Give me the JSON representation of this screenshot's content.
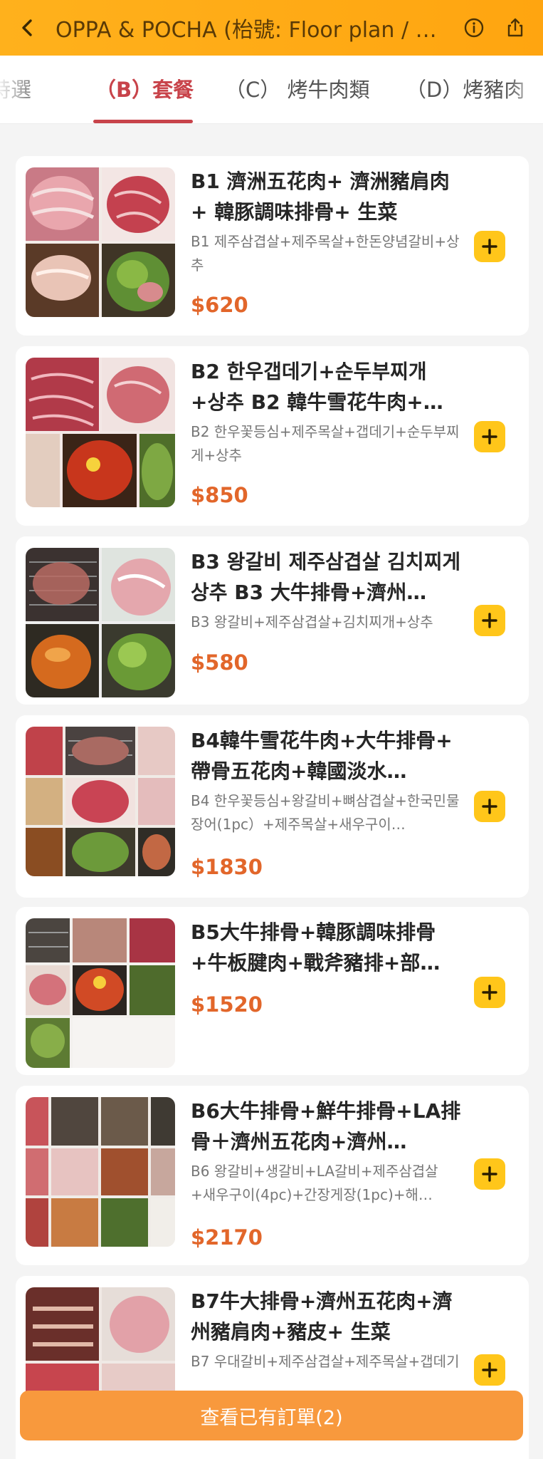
{
  "header": {
    "title": "OPPA & POCHA (枱號: Floor plan / …",
    "colors": {
      "bar": "#ffad16",
      "icon": "#4a3205"
    }
  },
  "tabs": [
    {
      "label": "特選",
      "active": false
    },
    {
      "label": "（B）套餐",
      "active": true
    },
    {
      "label": "（C） 烤牛肉類",
      "active": false
    },
    {
      "label": "（D）烤豬肉",
      "active": false
    }
  ],
  "menu": {
    "items": [
      {
        "title": "B1 濟洲五花肉+ 濟洲豬肩肉+ 韓豚調味排骨+ 生菜",
        "desc": "B1 제주삼겹살+제주목살+한돈양념갈비+상추",
        "price": "$620"
      },
      {
        "title": "B2 한우갭데기+순두부찌개+상추 B2 韓牛雪花牛肉+濟州…",
        "desc": "B2 한우꽃등심+제주목살+갭데기+순두부찌게+상추",
        "price": "$850"
      },
      {
        "title": "B3 왕갈비 제주삼겹살 김치찌게 상추 B3 大牛排骨+濟州…",
        "desc": "B3 왕갈비+제주삼겹살+김치찌개+상추",
        "price": "$580"
      },
      {
        "title": "B4韓牛雪花牛肉+大牛排骨+ 帶骨五花肉+韓國淡水…",
        "desc": "B4 한우꽃등심+왕갈비+뼈삼겹살+한국민물장어(1pc）+제주목살+새우구이…",
        "price": "$1830"
      },
      {
        "title": "B5大牛排骨+韓豚調味排骨+牛板腱肉+戰斧豬排+部…",
        "desc": "",
        "price": "$1520"
      },
      {
        "title": "B6大牛排骨+鮮牛排骨+LA排骨＋濟州五花肉+濟州…",
        "desc": "B6 왕갈비+생갈비+LA갈비+제주삼겹살+새우구이(4pc)+간장게장(1pc)+해…",
        "price": "$2170"
      },
      {
        "title": "B7牛大排骨+濟州五花肉+濟州豬肩肉+豬皮+ 生菜",
        "desc": "B7 우대갈비+제주삼겹살+제주목살+갭데기",
        "price": ""
      }
    ]
  },
  "order_bar": {
    "label": "查看已有訂單(2)"
  },
  "theme": {
    "accent": "#c8434a",
    "price": "#e2662a",
    "add_button": "#ffc61a",
    "order_bar": "#f8993d"
  }
}
